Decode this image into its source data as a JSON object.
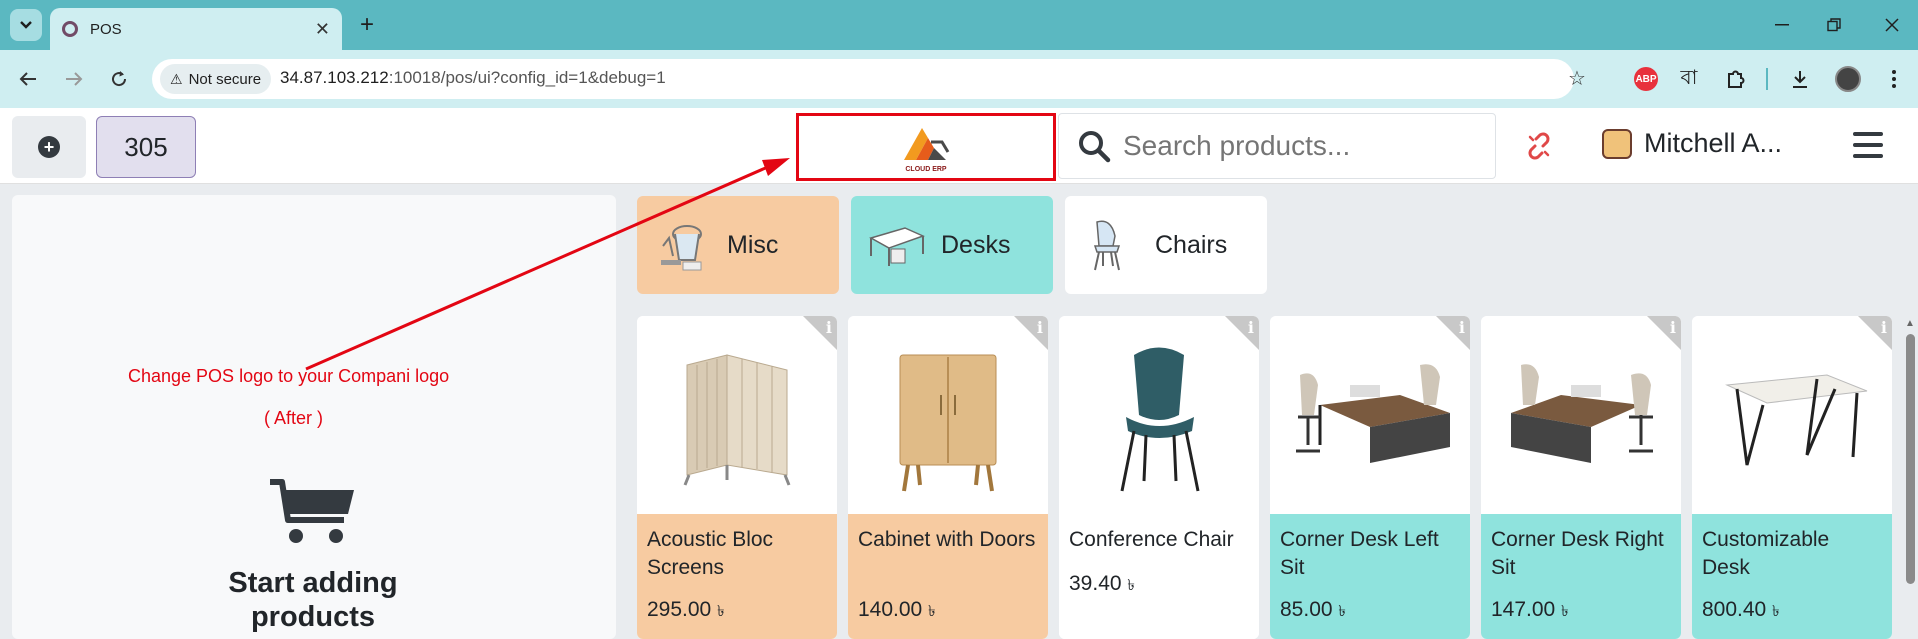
{
  "browser": {
    "tab_title": "POS",
    "security_label": "Not secure",
    "url_host": "34.87.103.212",
    "url_rest": ":10018/pos/ui?config_id=1&debug=1",
    "extensions": [
      "abp-icon",
      "bangla-icon",
      "puzzle-icon"
    ],
    "abp_text": "ABP",
    "bn_text": "বা"
  },
  "pos": {
    "order_number": "305",
    "logo_text": "CLOUD ERP",
    "search_placeholder": "Search products...",
    "cashier_name": "Mitchell A..."
  },
  "annotation": {
    "line1": "Change POS logo to your Compani logo",
    "line2": "( After )",
    "color": "#e30613"
  },
  "order_panel": {
    "empty_title": "Start adding products"
  },
  "categories": [
    {
      "label": "Misc",
      "color": "#f7cba1"
    },
    {
      "label": "Desks",
      "color": "#8fe3dd"
    },
    {
      "label": "Chairs",
      "color": "#ffffff"
    }
  ],
  "products": [
    {
      "name": "Acoustic Bloc Screens",
      "price": "295.00",
      "currency": "৳",
      "color": "#f7cba1"
    },
    {
      "name": "Cabinet with Doors",
      "price": "140.00",
      "currency": "৳",
      "color": "#f7cba1"
    },
    {
      "name": "Conference Chair",
      "price": "39.40",
      "currency": "৳",
      "color": "#ffffff"
    },
    {
      "name": "Corner Desk Left Sit",
      "price": "85.00",
      "currency": "৳",
      "color": "#8fe3dd"
    },
    {
      "name": "Corner Desk Right Sit",
      "price": "147.00",
      "currency": "৳",
      "color": "#8fe3dd"
    },
    {
      "name": "Customizable Desk",
      "price": "800.40",
      "currency": "৳",
      "color": "#8fe3dd"
    }
  ]
}
